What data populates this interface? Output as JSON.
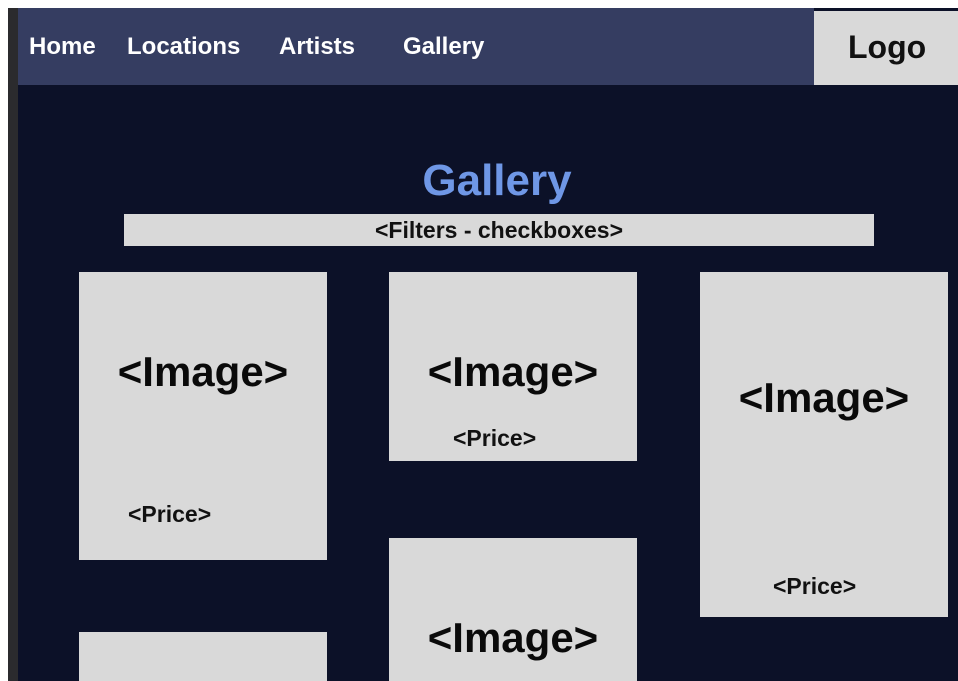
{
  "nav": {
    "items": [
      {
        "label": "Home"
      },
      {
        "label": "Locations"
      },
      {
        "label": "Artists"
      },
      {
        "label": "Gallery"
      }
    ],
    "logo": "Logo"
  },
  "page": {
    "title": "Gallery",
    "filters_placeholder": "<Filters - checkboxes>"
  },
  "cards": [
    {
      "image": "<Image>",
      "price": "<Price>"
    },
    {
      "image": "<Image>",
      "price": "<Price>"
    },
    {
      "image": "<Image>",
      "price": "<Price>"
    },
    {
      "image": "<Image>"
    },
    {
      "image": ""
    }
  ],
  "colors": {
    "background": "#0c1128",
    "navbar": "#353d61",
    "title": "#6f97e6",
    "placeholder": "#d9d9d9"
  }
}
